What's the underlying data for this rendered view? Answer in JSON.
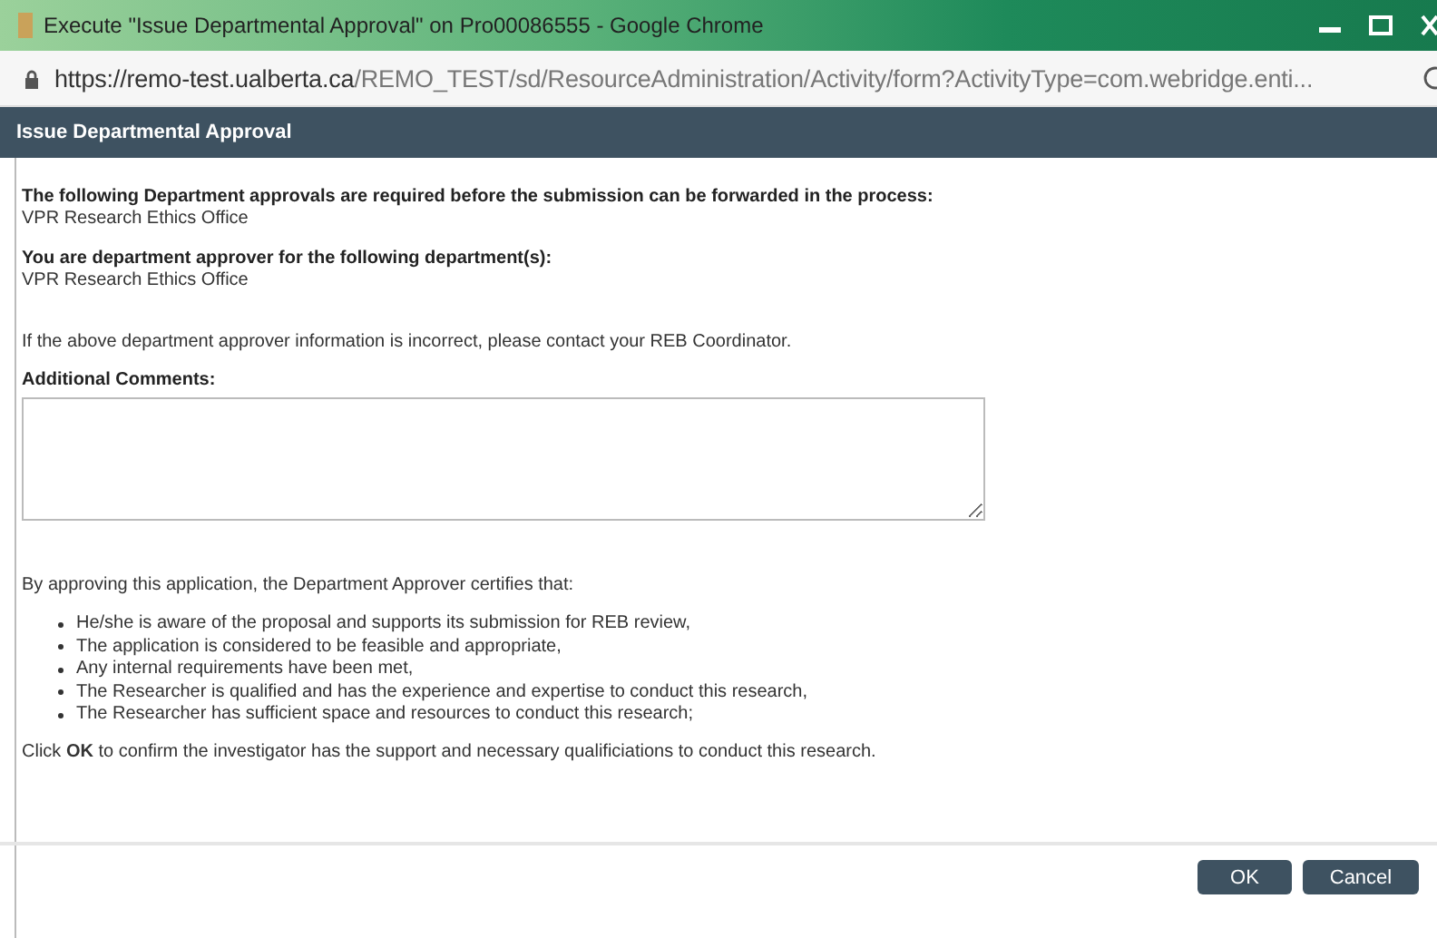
{
  "window": {
    "title": "Execute \"Issue Departmental Approval\" on Pro00086555 - Google Chrome"
  },
  "address_bar": {
    "host": "https://remo-test.ualberta.ca",
    "path": "/REMO_TEST/sd/ResourceAdministration/Activity/form?ActivityType=com.webridge.enti..."
  },
  "header": {
    "title": "Issue Departmental Approval"
  },
  "sections": [
    {
      "heading": "The following Department approvals are required before the submission can be forwarded in the process:",
      "value": "VPR Research Ethics Office"
    },
    {
      "heading": "You are department approver for the following department(s):",
      "value": "VPR Research Ethics Office"
    }
  ],
  "notice": "If the above department approver information is incorrect, please contact your REB Coordinator.",
  "comments": {
    "label": "Additional Comments:"
  },
  "certification": {
    "intro": "By approving this application, the Department Approver certifies that:",
    "items": [
      "He/she is aware of the proposal and supports its submission for REB review,",
      "The application is considered to be feasible and appropriate,",
      "Any internal requirements have been met,",
      "The Researcher is qualified and has the experience and expertise to conduct this research,",
      "The Researcher has sufficient space and resources to conduct this research;"
    ],
    "confirm": "Click **OK** to confirm the investigator has the support and necessary qualificiations to conduct this research."
  },
  "buttons": [
    "OK",
    "Cancel"
  ]
}
